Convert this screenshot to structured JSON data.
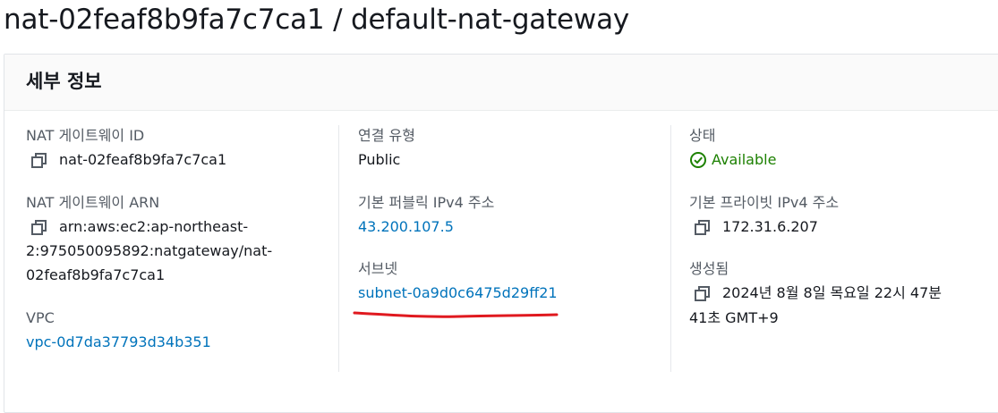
{
  "header": {
    "title": "nat-02feaf8b9fa7c7ca1 / default-nat-gateway"
  },
  "panel": {
    "title": "세부 정보"
  },
  "col1": {
    "nat_id_label": "NAT 게이트웨이 ID",
    "nat_id_value": "nat-02feaf8b9fa7c7ca1",
    "arn_label": "NAT 게이트웨이 ARN",
    "arn_line1": "arn:aws:ec2:ap-northeast-",
    "arn_line2": "2:975050095892:natgateway/nat-",
    "arn_line3": "02feaf8b9fa7c7ca1",
    "vpc_label": "VPC",
    "vpc_value": "vpc-0d7da37793d34b351"
  },
  "col2": {
    "conn_type_label": "연결 유형",
    "conn_type_value": "Public",
    "public_ip_label": "기본 퍼블릭 IPv4 주소",
    "public_ip_value": "43.200.107.5",
    "subnet_label": "서브넷",
    "subnet_value": "subnet-0a9d0c6475d29ff21"
  },
  "col3": {
    "state_label": "상태",
    "state_value": "Available",
    "private_ip_label": "기본 프라이빗 IPv4 주소",
    "private_ip_value": "172.31.6.207",
    "created_label": "생성됨",
    "created_line1": "2024년 8월 8일 목요일 22시 47분",
    "created_line2": "41초 GMT+9"
  },
  "icons": {
    "copy": "copy-icon",
    "status": "check-circle-icon"
  },
  "colors": {
    "link": "#0073bb",
    "success": "#1d8102",
    "annotation": "#e0191f"
  }
}
